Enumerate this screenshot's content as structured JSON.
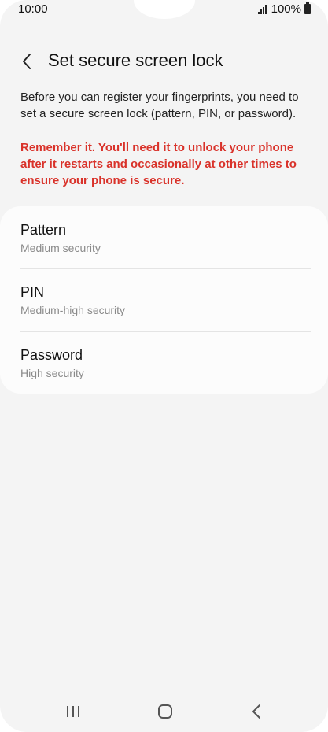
{
  "status_bar": {
    "time": "10:00",
    "battery": "100%",
    "signal_icon": "signal-icon",
    "battery_icon": "battery-icon"
  },
  "header": {
    "title": "Set secure screen lock",
    "back_icon": "chevron-left-icon"
  },
  "description": "Before you can register your fingerprints, you need to set a secure screen lock (pattern, PIN, or password).",
  "warning": "Remember it. You'll need it to unlock your phone after it restarts and occasionally at other times to ensure your phone is secure.",
  "options": [
    {
      "title": "Pattern",
      "subtitle": "Medium security"
    },
    {
      "title": "PIN",
      "subtitle": "Medium-high security"
    },
    {
      "title": "Password",
      "subtitle": "High security"
    }
  ],
  "nav_bar": {
    "recents_icon": "recents-icon",
    "home_icon": "home-icon",
    "back_icon": "back-icon"
  },
  "colors": {
    "background": "#f4f4f4",
    "card": "#fcfcfc",
    "warning": "#d9322a",
    "subtitle": "#8a8a8a"
  }
}
